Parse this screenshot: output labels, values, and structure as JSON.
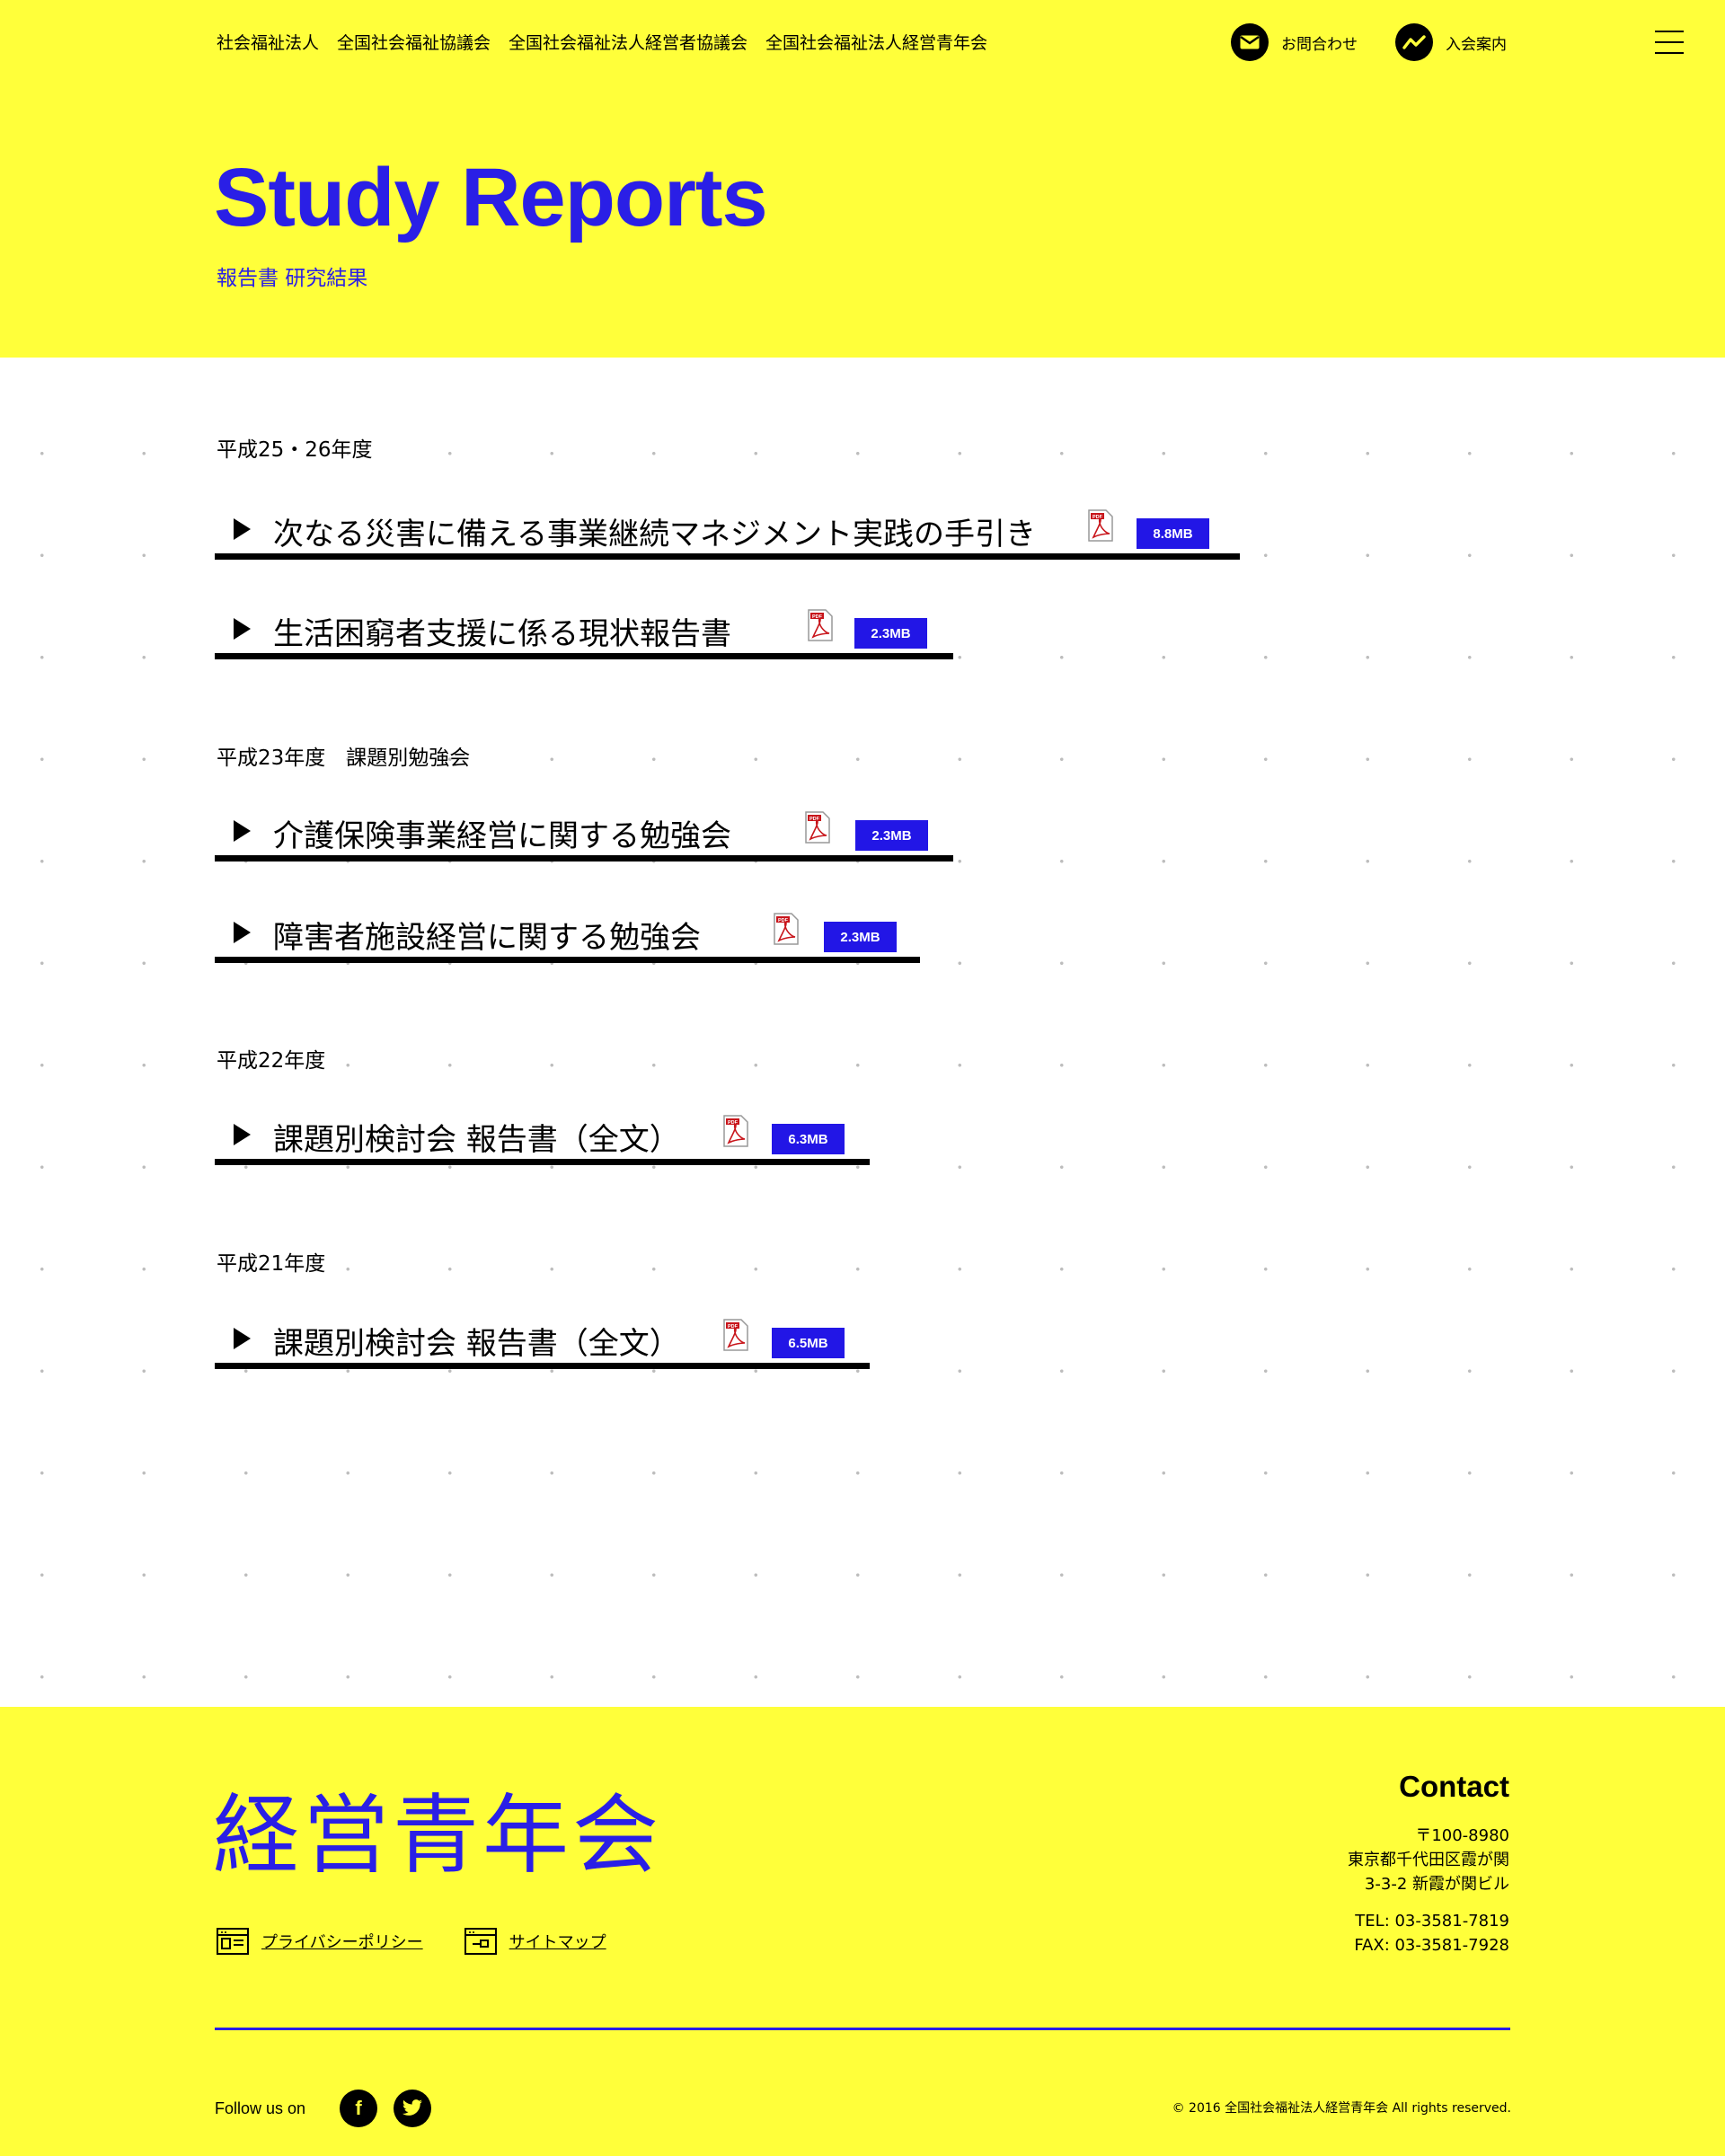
{
  "header": {
    "top_links": [
      "社会福祉法人",
      "全国社会福祉協議会",
      "全国社会福祉法人経営者協議会",
      "全国社会福祉法人経営青年会"
    ],
    "contact_label": "お問合わせ",
    "join_label": "入会案内",
    "icons": {
      "contact": "mail-icon",
      "join": "chart-line-icon",
      "menu": "hamburger-menu-icon"
    }
  },
  "page": {
    "title": "Study Reports",
    "subtitle": "報告書 研究結果"
  },
  "sections": [
    {
      "year": "平成25・26年度",
      "reports": [
        {
          "title": "次なる災害に備える事業継続マネジメント実践の手引き",
          "size": "8.8MB"
        },
        {
          "title": "生活困窮者支援に係る現状報告書",
          "size": "2.3MB"
        }
      ]
    },
    {
      "year": "平成23年度　課題別勉強会",
      "reports": [
        {
          "title": "介護保険事業経営に関する勉強会",
          "size": "2.3MB"
        },
        {
          "title": "障害者施設経営に関する勉強会",
          "size": "2.3MB"
        }
      ]
    },
    {
      "year": "平成22年度",
      "reports": [
        {
          "title": "課題別検討会 報告書（全文）",
          "size": "6.3MB"
        }
      ]
    },
    {
      "year": "平成21年度",
      "reports": [
        {
          "title": "課題別検討会 報告書（全文）",
          "size": "6.5MB"
        }
      ]
    }
  ],
  "pdf_label": "PDF",
  "footer": {
    "logo": "経営青年会",
    "links": [
      "プライバシーポリシー",
      "サイトマップ"
    ],
    "contact": {
      "heading": "Contact",
      "postal": "〒100-8980",
      "address1": "東京都千代田区霞が関",
      "address2": "3-3-2 新霞が関ビル",
      "tel": "TEL: 03-3581-7819",
      "fax": "FAX: 03-3581-7928"
    },
    "follow_label": "Follow us on",
    "social": {
      "facebook": "f",
      "twitter": "t"
    },
    "copyright": "© 2016 全国社会福祉法人経営青年会 All rights reserved."
  },
  "colors": {
    "accent_yellow": "#ffff3a",
    "brand_blue": "#2a1fe6",
    "badge_blue": "#2216e6"
  }
}
